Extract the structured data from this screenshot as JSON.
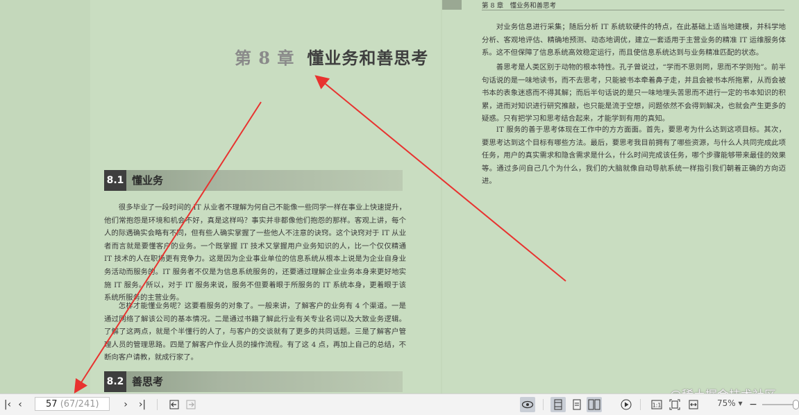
{
  "book": {
    "chapter_num": "第 8 章",
    "chapter_title": "懂业务和善思考",
    "running_head": "第 8 章　懂业务和善思考",
    "sections": [
      {
        "num": "8.1",
        "title": "懂业务"
      },
      {
        "num": "8.2",
        "title": "善思考"
      }
    ],
    "left_paragraphs": [
      "很多毕业了一段时间的 IT 从业者不理解为何自己不能像一些同学一样在事业上快速提升，他们常抱怨是环境和机会不好，真是这样吗？事实并非都像他们抱怨的那样。客观上讲，每个人的际遇确实会略有不同，但有些人确实掌握了一些他人不注意的诀窍。这个诀窍对于 IT 从业者而言就是要懂客户的业务。一个既掌握 IT 技术又掌握用户业务知识的人，比一个仅仅精通 IT 技术的人在职场更有竞争力。这是因为企业事业单位的信息系统从根本上说是为企业自身业务活动而服务的。IT 服务者不仅是为信息系统服务的，还要通过理解企业业务本身来更好地实施 IT 服务。所以，对于 IT 服务来说，服务不但要着眼于所服务的 IT 系统本身，更着眼于该系统所服务的主营业务。",
      "怎样才能懂业务呢？这要看服务的对象了。一般来讲，了解客户的业务有 4 个渠道。一是通过网络了解该公司的基本情况。二是通过书籍了解此行业有关专业名词以及大致业务逻辑。了解了这两点，就是个半懂行的人了，与客户的交谈就有了更多的共同话题。三是了解客户管理人员的管理思路。四是了解客户作业人员的操作流程。有了这 4 点，再加上自己的总结，不断向客户请教，就成行家了。"
    ],
    "right_paragraphs": [
      "对业务信息进行采集；随后分析 IT 系统软硬件的特点，在此基础上适当地建模，并科学地分析、客观地评估、精确地预测、动态地调优，建立一套适用于主营业务的精准 IT 运维服务体系。这不但保障了信息系统高效稳定运行，而且使信息系统达到与业务精准匹配的状态。",
      "善思考是人类区别于动物的根本特性。孔子曾说过，“学而不思则罔，思而不学则殆”。前半句话说的是一味地读书，而不去思考，只能被书本牵着鼻子走，并且会被书本所拖累，从而会被书本的表象迷惑而不得其解；而后半句话说的是只一味地埋头苦思而不进行一定的书本知识的积累，进而对知识进行研究推敲，也只能是流于空想，问题依然不会得到解决，也就会产生更多的疑惑。只有把学习和思考结合起来，才能学到有用的真知。",
      "IT 服务的善于思考体现在工作中的方方面面。首先，要思考为什么达到这项目标。其次，要思考达到这个目标有哪些方法。最后，要思考我目前拥有了哪些资源，与什么人共同完成此项任务，用户的真实需求和隐含需求是什么，什么时间完成该任务，哪个步骤能够带来最佳的效果等。通过多问自己几个为什么，我们的大脑就像自动导航系统一样指引我们朝着正确的方向迈进。"
    ]
  },
  "toolbar": {
    "page_current": "57",
    "page_total": "(67/241)",
    "zoom": "75%",
    "watermark": "@稀土掘金技术社区"
  },
  "colors": {
    "page_bg": "#c9ddc1",
    "annotation_red": "#e8322f",
    "toolbar_bg": "#f3f3f3"
  }
}
